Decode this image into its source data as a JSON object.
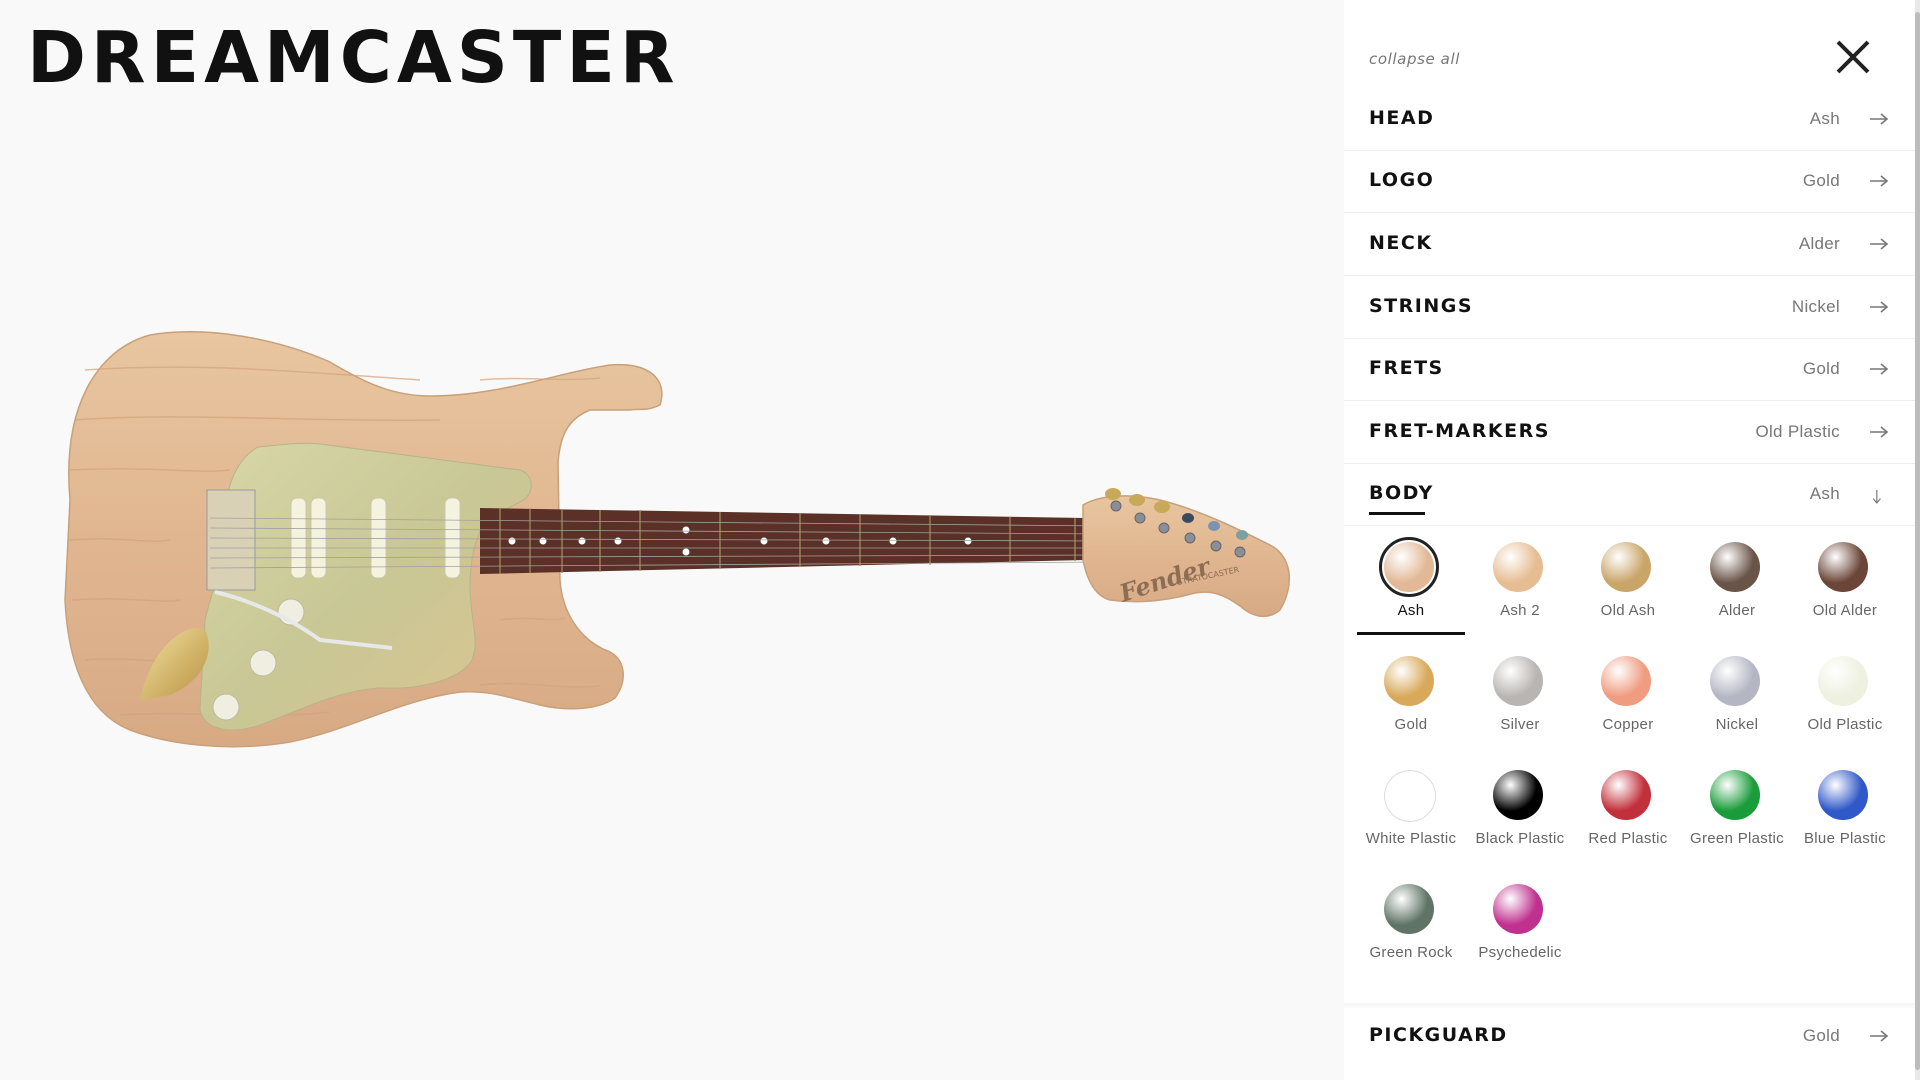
{
  "brand": {
    "title": "DREAMCASTER"
  },
  "guitar": {
    "headstock_logo": "Fender",
    "headstock_model": "STRATOCASTER"
  },
  "panel": {
    "collapse_all": "collapse all",
    "close_icon": "close-icon",
    "rows": [
      {
        "name": "HEAD",
        "value": "Ash",
        "icon": "arrow-right-icon"
      },
      {
        "name": "LOGO",
        "value": "Gold",
        "icon": "arrow-right-icon"
      },
      {
        "name": "NECK",
        "value": "Alder",
        "icon": "arrow-right-icon"
      },
      {
        "name": "STRINGS",
        "value": "Nickel",
        "icon": "arrow-right-icon"
      },
      {
        "name": "FRETS",
        "value": "Gold",
        "icon": "arrow-right-icon"
      },
      {
        "name": "FRET-MARKERS",
        "value": "Old Plastic",
        "icon": "arrow-right-icon"
      },
      {
        "name": "BODY",
        "value": "Ash",
        "icon": "arrow-down-icon",
        "expanded": true
      }
    ],
    "materials": [
      {
        "label": "Ash",
        "color": "#e2b896",
        "selected": true
      },
      {
        "label": "Ash 2",
        "color": "#e6bd92"
      },
      {
        "label": "Old Ash",
        "color": "#c9a56a"
      },
      {
        "label": "Alder",
        "color": "#6a5448"
      },
      {
        "label": "Old Alder",
        "color": "#6b4538"
      },
      {
        "label": "Gold",
        "color": "#d8a95a"
      },
      {
        "label": "Silver",
        "color": "#b9b5b3"
      },
      {
        "label": "Copper",
        "color": "#ef9c80"
      },
      {
        "label": "Nickel",
        "color": "#b4b6c4"
      },
      {
        "label": "Old Plastic",
        "color": "#eef0e0"
      },
      {
        "label": "White Plastic",
        "color": "#ffffff"
      },
      {
        "label": "Black Plastic",
        "color": "#000000"
      },
      {
        "label": "Red Plastic",
        "color": "#c2303b"
      },
      {
        "label": "Green Plastic",
        "color": "#1a9c3a"
      },
      {
        "label": "Blue Plastic",
        "color": "#2f58c8"
      },
      {
        "label": "Green Rock",
        "color": "#5f7467"
      },
      {
        "label": "Psychedelic",
        "color": "#c0308e"
      }
    ],
    "footer_row": {
      "name": "PICKGUARD",
      "value": "Gold",
      "icon": "arrow-right-icon"
    }
  }
}
